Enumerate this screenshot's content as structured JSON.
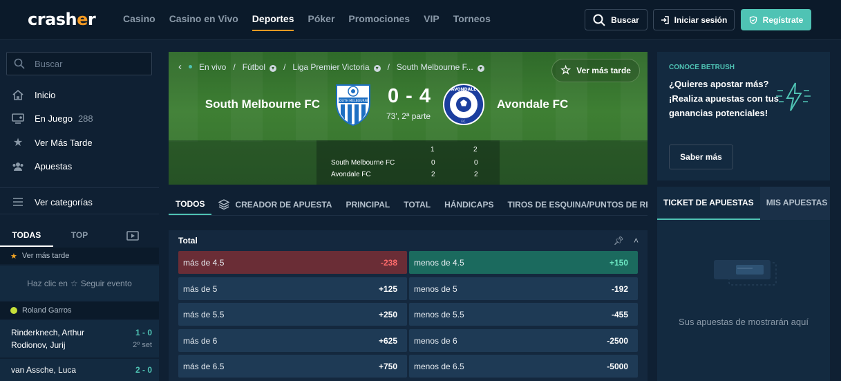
{
  "brand": {
    "logo_text_a": "crash",
    "logo_text_b": "e",
    "logo_text_c": "r",
    "accent": "#f59a23",
    "teal": "#4fc3b4"
  },
  "nav": {
    "items": [
      "Casino",
      "Casino en Vivo",
      "Deportes",
      "Póker",
      "Promociones",
      "VIP",
      "Torneos"
    ],
    "active": "Deportes"
  },
  "header_buttons": {
    "search": "Buscar",
    "login": "Iniciar sesión",
    "register": "Regístrate"
  },
  "sidebar": {
    "search_placeholder": "Buscar",
    "menu": [
      {
        "label": "Inicio",
        "icon": "home-icon"
      },
      {
        "label": "En Juego",
        "count": "288",
        "icon": "live-tv-icon"
      },
      {
        "label": "Ver Más Tarde",
        "icon": "star-icon"
      },
      {
        "label": "Apuestas",
        "icon": "users-icon"
      }
    ],
    "categories": "Ver categorías",
    "tabs": [
      "TODAS",
      "TOP"
    ],
    "watch_later_header": "Ver más tarde",
    "follow_prefix": "Haz clic en",
    "follow_suffix": "Seguir evento",
    "tournament": "Roland Garros",
    "matches": [
      {
        "p1": "Rinderknech, Arthur",
        "p2": "Rodionov, Jurij",
        "score": "1 - 0",
        "set": "2º set"
      },
      {
        "p1": "van Assche, Luca",
        "score": "2 - 0"
      }
    ]
  },
  "event": {
    "breadcrumbs": [
      "En vivo",
      "Fútbol",
      "Liga Premier Victoria",
      "South Melbourne F..."
    ],
    "watch_later": "Ver más tarde",
    "home": "South Melbourne FC",
    "away": "Avondale FC",
    "home_crest_text": "SOUTH MELBOURNE",
    "away_crest_text": "AVONDALE",
    "away_crest_sub": "F.C.",
    "score": "0 - 4",
    "time": "73', 2ª parte",
    "periods": [
      "1",
      "2"
    ],
    "rows": [
      {
        "team": "South Melbourne FC",
        "p1": "0",
        "p2": "0"
      },
      {
        "team": "Avondale FC",
        "p1": "2",
        "p2": "2"
      }
    ]
  },
  "market_tabs": [
    "TODOS",
    "CREADOR DE APUESTA",
    "PRINCIPAL",
    "TOTAL",
    "HÁNDICAPS",
    "TIROS DE ESQUINA/PUNTOS DE RESERVA"
  ],
  "market": {
    "title": "Total",
    "rows": [
      {
        "over": "más de 4.5",
        "over_odd": "-238",
        "under": "menos de 4.5",
        "under_odd": "+150"
      },
      {
        "over": "más de 5",
        "over_odd": "+125",
        "under": "menos de 5",
        "under_odd": "-192"
      },
      {
        "over": "más de 5.5",
        "over_odd": "+250",
        "under": "menos de 5.5",
        "under_odd": "-455"
      },
      {
        "over": "más de 6",
        "over_odd": "+625",
        "under": "menos de 6",
        "under_odd": "-2500"
      },
      {
        "over": "más de 6.5",
        "over_odd": "+750",
        "under": "menos de 6.5",
        "under_odd": "-5000"
      }
    ]
  },
  "promo": {
    "eyebrow": "CONOCE BETRUSH",
    "headline": "¿Quieres apostar más? ¡Realiza apuestas con tus ganancias potenciales!",
    "cta": "Saber más"
  },
  "betslip": {
    "tabs": [
      "TICKET DE APUESTAS",
      "MIS APUESTAS"
    ],
    "empty": "Sus apuestas de mostrarán aquí"
  }
}
